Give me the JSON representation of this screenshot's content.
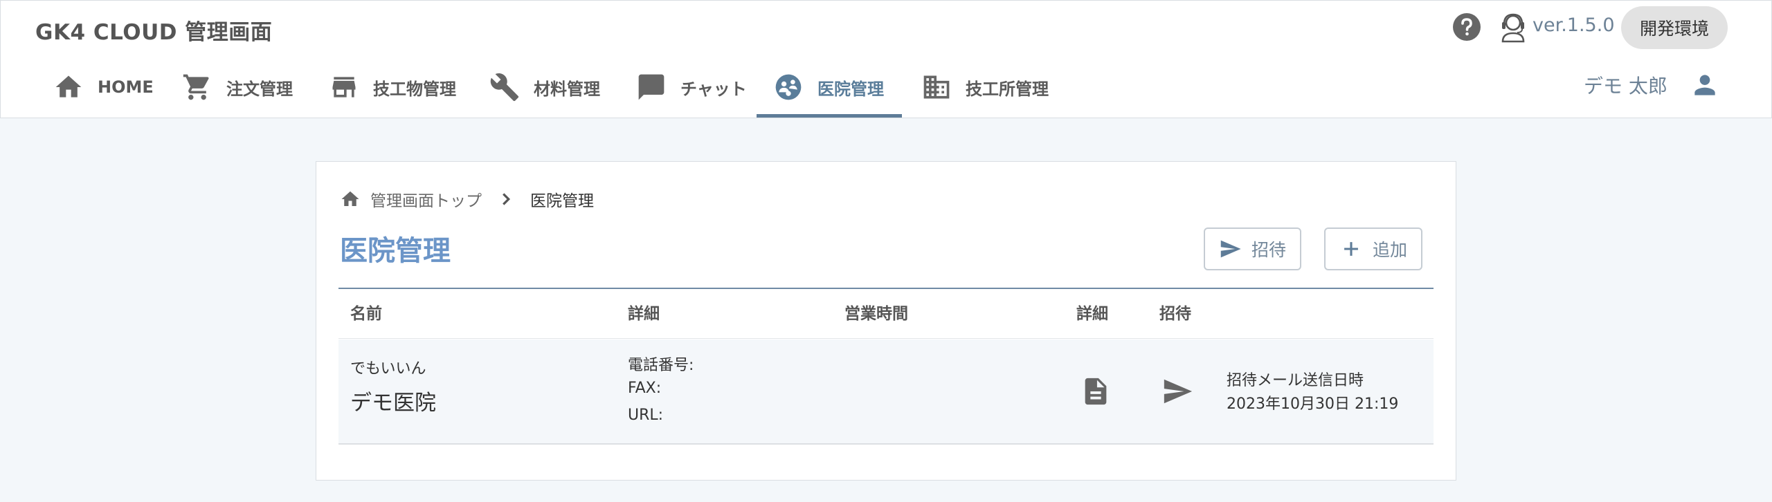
{
  "app": {
    "title": "GK4 CLOUD 管理画面",
    "version": "ver.1.5.0",
    "env_label": "開発環境"
  },
  "nav": {
    "items": [
      {
        "label": "HOME",
        "icon": "home-icon"
      },
      {
        "label": "注文管理",
        "icon": "cart-icon"
      },
      {
        "label": "技工物管理",
        "icon": "store-icon"
      },
      {
        "label": "材料管理",
        "icon": "wrench-icon"
      },
      {
        "label": "チャット",
        "icon": "chat-icon"
      },
      {
        "label": "医院管理",
        "icon": "clinic-icon",
        "active": true
      },
      {
        "label": "技工所管理",
        "icon": "building-icon"
      }
    ]
  },
  "user": {
    "name": "デモ 太郎"
  },
  "breadcrumb": {
    "home_label": "管理画面トップ",
    "current": "医院管理"
  },
  "page": {
    "title": "医院管理",
    "invite_button": "招待",
    "add_button": "追加"
  },
  "table": {
    "headers": [
      "名前",
      "詳細",
      "営業時間",
      "詳細",
      "招待"
    ],
    "rows": [
      {
        "kana": "でもいいん",
        "name": "デモ医院",
        "phone_label": "電話番号:",
        "fax_label": "FAX:",
        "url_label": "URL:",
        "hours": "",
        "invite_sent_label": "招待メール送信日時",
        "invite_sent_at": "2023年10月30日 21:19"
      }
    ]
  },
  "colors": {
    "accent": "#5e7c98",
    "title": "#6b95c8",
    "background": "#f3f7fa"
  }
}
